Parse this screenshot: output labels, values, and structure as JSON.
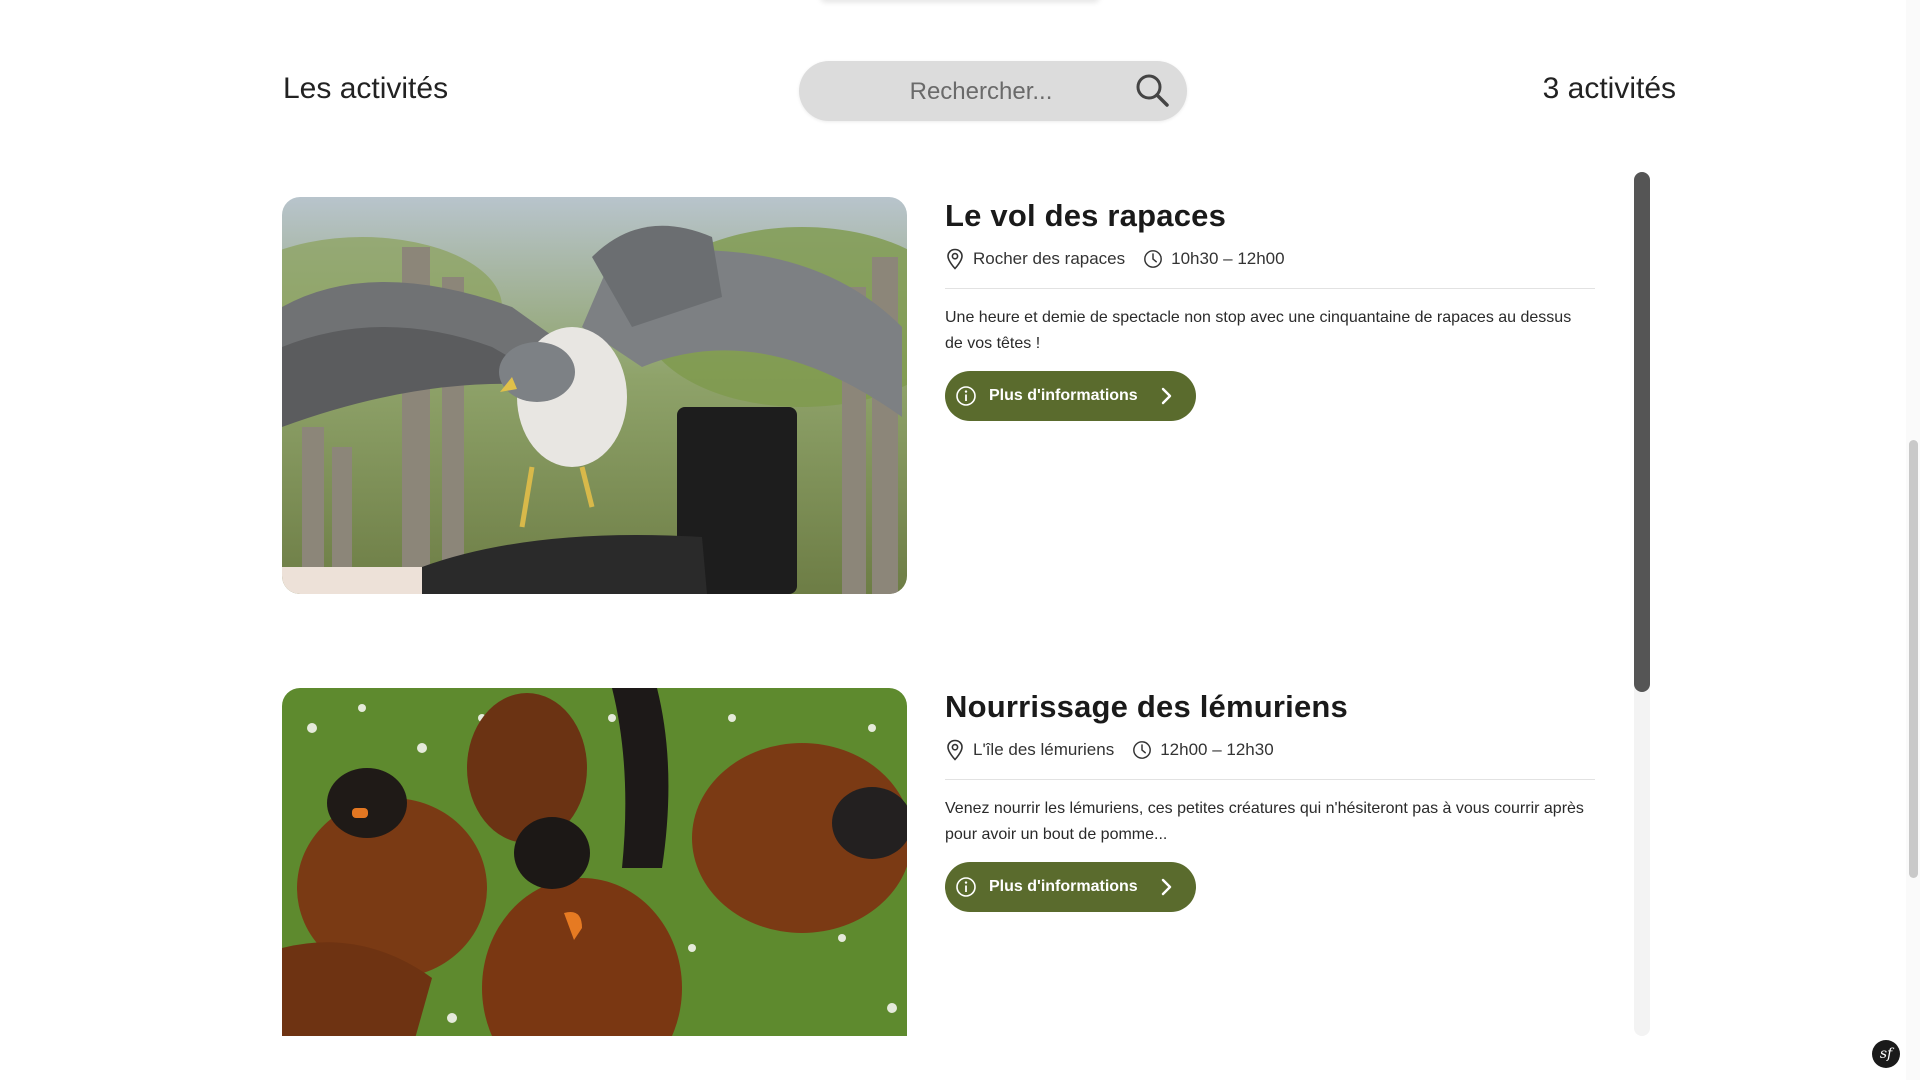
{
  "header": {
    "title": "Les activités",
    "search_placeholder": "Rechercher...",
    "count_label": "3 activités"
  },
  "activities": [
    {
      "title": "Le vol des rapaces",
      "location": "Rocher des rapaces",
      "time": "10h30 – 12h00",
      "description": "Une heure et demie de spectacle non stop avec une cinquantaine de rapaces au dessus de vos têtes !",
      "button_label": "Plus d'informations"
    },
    {
      "title": "Nourrissage des lémuriens",
      "location": "L'île des lémuriens",
      "time": "12h00 – 12h30",
      "description": "Venez nourrir les lémuriens, ces petites créatures qui n'hésiteront pas à vous courrir après pour avoir un bout de pomme...",
      "button_label": "Plus d'informations"
    }
  ],
  "colors": {
    "button_bg": "#5a6b2d",
    "search_bg": "#dcdcdc",
    "scroll_thumb": "#555555"
  },
  "icons": [
    "search-icon",
    "location-pin-icon",
    "clock-icon",
    "info-icon",
    "chevron-right-icon",
    "symfony-logo-icon"
  ]
}
